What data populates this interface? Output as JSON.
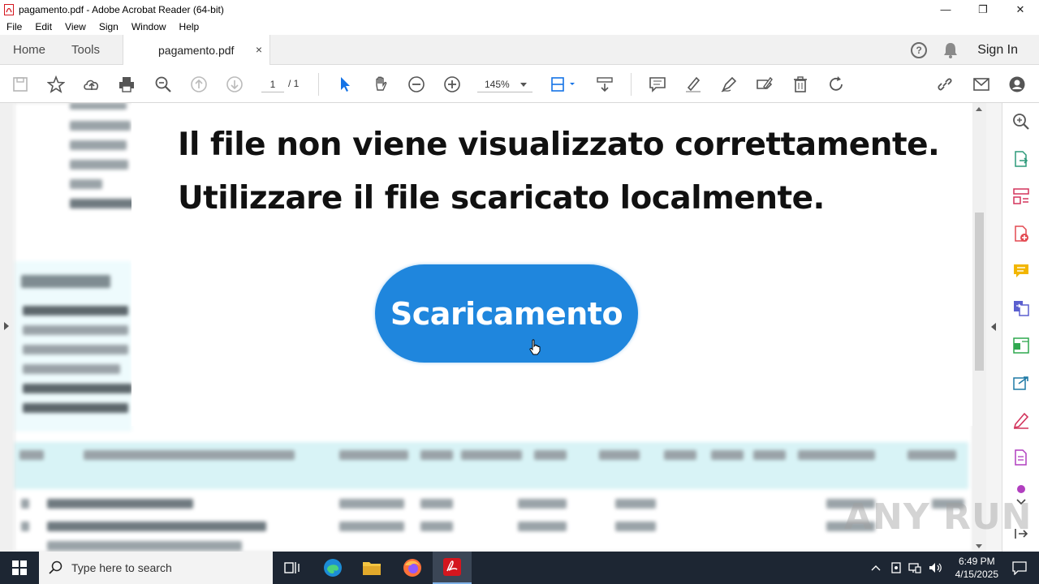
{
  "window": {
    "title": "pagamento.pdf - Adobe Acrobat Reader (64-bit)",
    "controls": [
      "minimize",
      "maximize",
      "close"
    ]
  },
  "menu": [
    "File",
    "Edit",
    "View",
    "Sign",
    "Window",
    "Help"
  ],
  "tabs": {
    "home": "Home",
    "tools": "Tools",
    "document": "pagamento.pdf",
    "close": "×",
    "sign_in": "Sign In"
  },
  "toolbar": {
    "page_current": "1",
    "page_total": "/ 1",
    "zoom": "145%"
  },
  "document": {
    "line1": "Il file non viene visualizzato correttamente.",
    "line2": "Utilizzare il file scaricato localmente.",
    "button": "Scaricamento"
  },
  "watermark": "ANY RUN",
  "taskbar": {
    "search_placeholder": "Type here to search",
    "time": "6:49 PM",
    "date": "4/15/2025"
  },
  "colors": {
    "accent": "#1f86dd",
    "acrobat_red": "#d4161e"
  }
}
